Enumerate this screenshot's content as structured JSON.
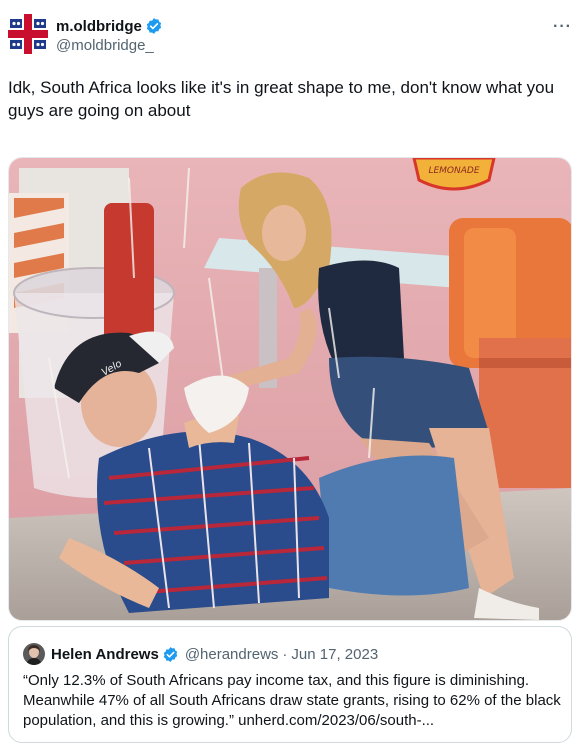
{
  "post": {
    "display_name": "m.oldbridge",
    "handle": "@moldbridge_",
    "more_label": "···",
    "text": "Idk, South Africa looks like it's in great shape to me, don't know what you guys are going on about",
    "avatar_icon": "flag-cross-avatar-icon",
    "verified_color": "#1d9bf0"
  },
  "media": {
    "sign_text": "LEMONADE",
    "cap_text": "Velo"
  },
  "quote": {
    "display_name": "Helen Andrews",
    "handle": "@herandrews",
    "separator": "·",
    "date": "Jun 17, 2023",
    "text": "“Only 12.3% of South Africans pay income tax, and this figure is diminishing. Meanwhile 47% of all South Africans draw state grants, rising to 62% of the black population, and this is growing.” unherd.com/2023/06/south-..."
  }
}
